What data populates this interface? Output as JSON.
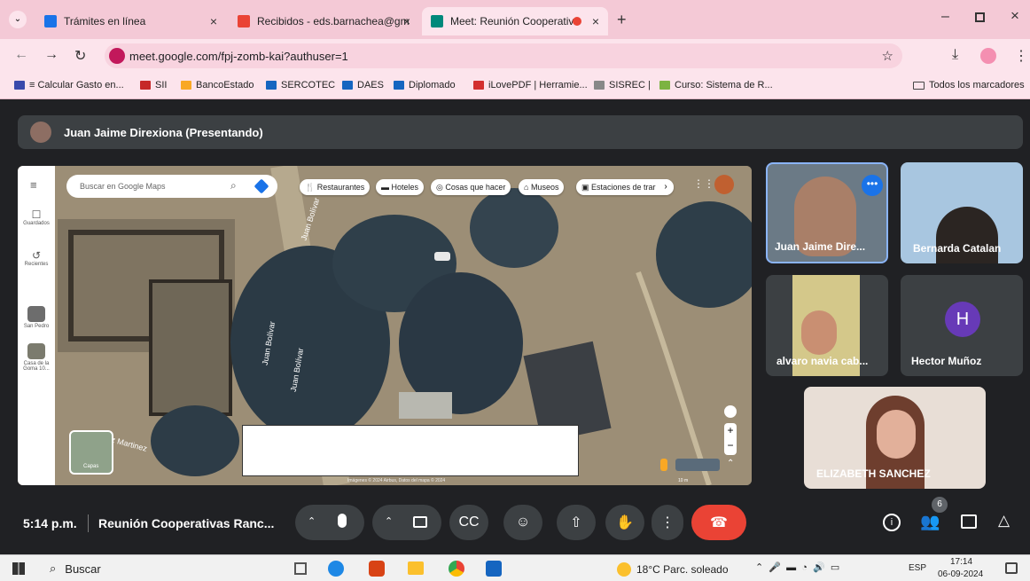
{
  "browser": {
    "tabs": [
      {
        "title": "Trámites en línea",
        "color": "#1a73e8"
      },
      {
        "title": "Recibidos - eds.barnachea@gm",
        "color": "#ea4335"
      },
      {
        "title": "Meet: Reunión Cooperativa",
        "color": "#00897b"
      }
    ],
    "url": "meet.google.com/fpj-zomb-kai?authuser=1",
    "bookmarks": [
      "≡ Calcular Gasto en...",
      "SII",
      "BancoEstado",
      "SERCOTEC",
      "DAES",
      "Diplomado",
      "iLovePDF | Herramie...",
      "SISREC |",
      "Curso: Sistema de R..."
    ],
    "bookmark_colors": [
      "#3949ab",
      "#c62828",
      "#f9a825",
      "#1565c0",
      "#1565c0",
      "#1565c0",
      "#d32f2f",
      "#666666",
      "#7cb342"
    ],
    "all_bookmarks": "Todos los marcadores"
  },
  "meet": {
    "presenter": "Juan Jaime Direxiona (Presentando)",
    "participants": [
      {
        "name": "Juan Jaime Dire..."
      },
      {
        "name": "Bernarda Catalan"
      },
      {
        "name": "alvaro navia cab..."
      },
      {
        "name": "Hector Muñoz",
        "initial": "H"
      },
      {
        "name": "ELIZABETH SANCHEZ"
      }
    ],
    "time": "5:14 p.m.",
    "meeting_title": "Reunión Cooperativas Ranc...",
    "people_count": "6",
    "end_color": "#ea4335"
  },
  "maps": {
    "search_placeholder": "Buscar en Google Maps",
    "chips": [
      "Restaurantes",
      "Hoteles",
      "Cosas que hacer",
      "Museos",
      "Estaciones de trar"
    ],
    "side": [
      "Guardados",
      "Recientes",
      "San Pedro",
      "Casa de la Goma 10..."
    ],
    "layers": "Capas",
    "streets": [
      "Juan Bolívar",
      "Juan Bolívar",
      "Juan Bolívar",
      "uz Martinez"
    ],
    "attribution": "Imágenes © 2024 Airbus, Datos del mapa © 2024",
    "scale": "10 m"
  },
  "taskbar": {
    "search": "Buscar",
    "weather": "18°C Parc. soleado",
    "lang": "ESP",
    "clock_time": "17:14",
    "clock_date": "06-09-2024"
  }
}
